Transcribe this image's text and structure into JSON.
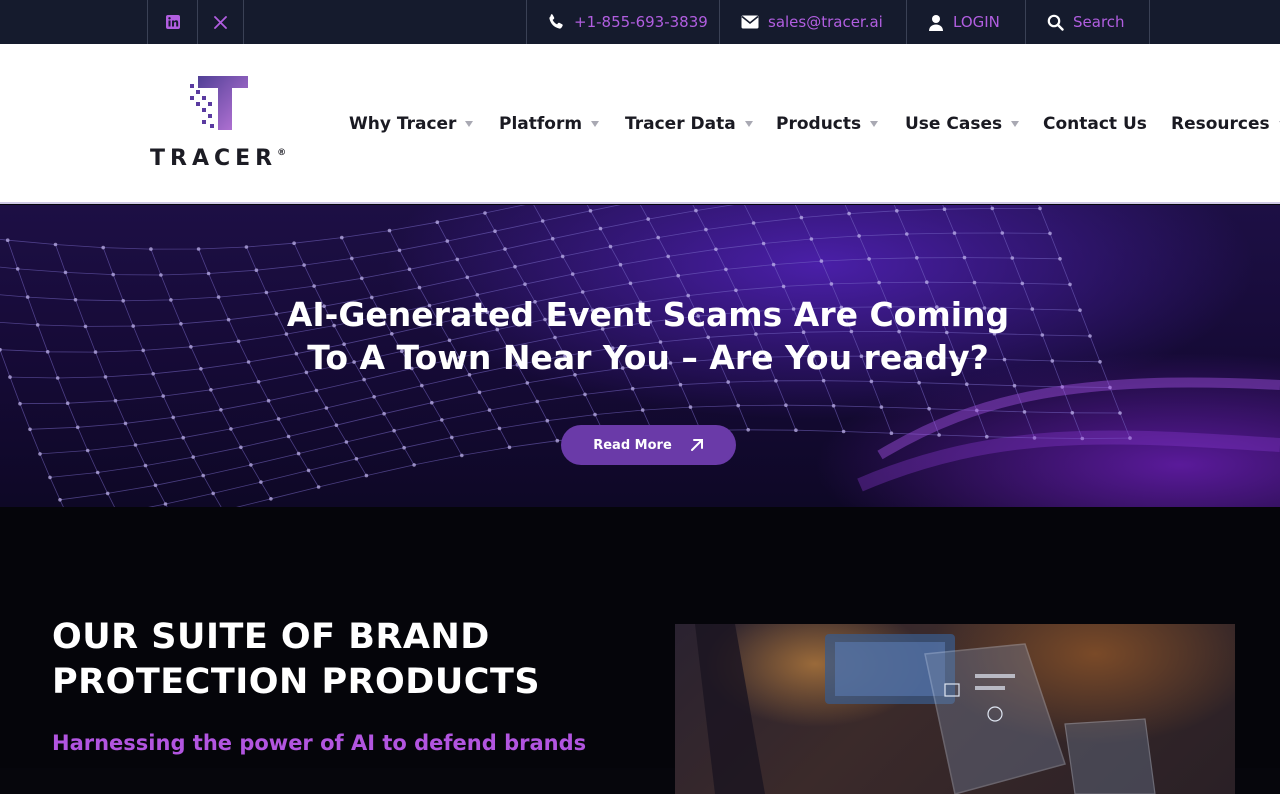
{
  "topbar": {
    "social": [
      {
        "icon": "linkedin-icon"
      },
      {
        "icon": "x-twitter-icon"
      }
    ],
    "phone": "+1-855-693-3839",
    "email": "sales@tracer.ai",
    "login": "LOGIN",
    "search": "Search",
    "link_color": "#b15ee0"
  },
  "header": {
    "logo_text": "TRACER",
    "logo_mark": "®",
    "nav": [
      {
        "label": "Why Tracer",
        "has_dropdown": true
      },
      {
        "label": "Platform",
        "has_dropdown": true
      },
      {
        "label": "Tracer Data",
        "has_dropdown": true
      },
      {
        "label": "Products",
        "has_dropdown": true
      },
      {
        "label": "Use Cases",
        "has_dropdown": true
      },
      {
        "label": "Contact Us",
        "has_dropdown": false
      },
      {
        "label": "Resources",
        "has_dropdown": true
      }
    ]
  },
  "hero": {
    "title_line1": "AI-Generated Event Scams Are Coming",
    "title_line2": "To A Town Near You – Are You ready?",
    "button": "Read More",
    "button_color": "#6a3aa8"
  },
  "products": {
    "title_line1": "OUR SUITE OF BRAND",
    "title_line2": "PROTECTION PRODUCTS",
    "subtitle": "Harnessing the power of AI to defend brands",
    "subtitle_color": "#b255e0"
  }
}
